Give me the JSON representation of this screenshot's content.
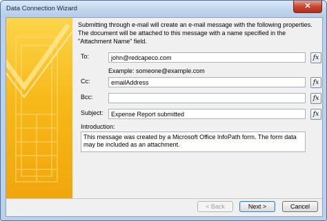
{
  "window": {
    "title": "Data Connection Wizard",
    "close_glyph": "✕"
  },
  "intro_text": "Submitting through e-mail will create an e-mail message with the following properties. The document will be attached to this message with a name specified in the \"Attachment Name\" field.",
  "fields": {
    "to": {
      "label": "To:",
      "value": "john@redcapeco.com"
    },
    "example": "Example: someone@example.com",
    "cc": {
      "label": "Cc:",
      "value": "emailAddress"
    },
    "bcc": {
      "label": "Bcc:",
      "value": ""
    },
    "subject": {
      "label": "Subject:",
      "value": "Expense Report submitted"
    },
    "introduction": {
      "label": "Introduction:",
      "value": "This message was created by a Microsoft Office InfoPath form. The form data may be included as an attachment."
    }
  },
  "fx_label": "fx",
  "buttons": {
    "back": "< Back",
    "next": "Next >",
    "cancel": "Cancel"
  },
  "colors": {
    "banner_yellow": "#f7b91a",
    "accent_border": "#3c7fb1"
  },
  "icons": {
    "close": "close-icon",
    "formula": "function-icon",
    "banner": "wizard-banner-graphic"
  }
}
